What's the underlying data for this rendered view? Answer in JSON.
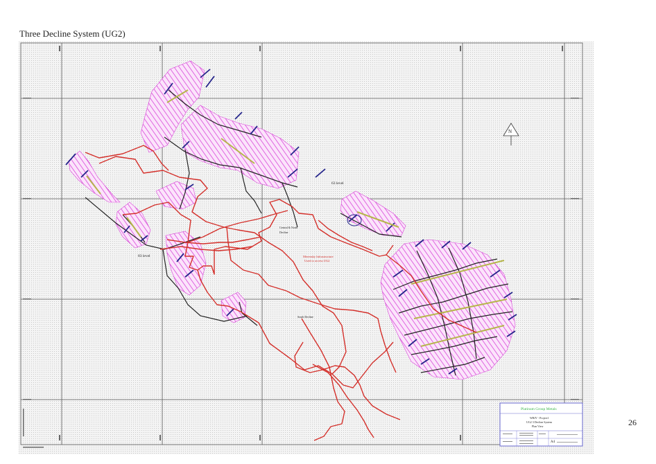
{
  "slide": {
    "title": "Three Decline System (UG2)",
    "page_number": "26"
  },
  "map": {
    "labels": {
      "level_63": "63 level",
      "level_83": "83 level",
      "central_north_decline": "Central & North\nDecline",
      "south_decline": "South Decline",
      "infrastructure_line1": "Merensky Infrastructure",
      "infrastructure_line2": "Used to access UG2"
    },
    "north_arrow": "N",
    "title_block": {
      "company": "Platinum Group Metals",
      "line1": "WBJV - Project1",
      "line2": "UG2 3 Decline System",
      "line3": "Plan View",
      "sheet_size": "A4"
    },
    "colors": {
      "declines": "#d4302b",
      "stope_hatch": "#e050e0",
      "raise_lines": "#2a2a8a",
      "drives": "#222222",
      "title_green": "#39b54a",
      "title_border": "#6a6ad0"
    }
  }
}
